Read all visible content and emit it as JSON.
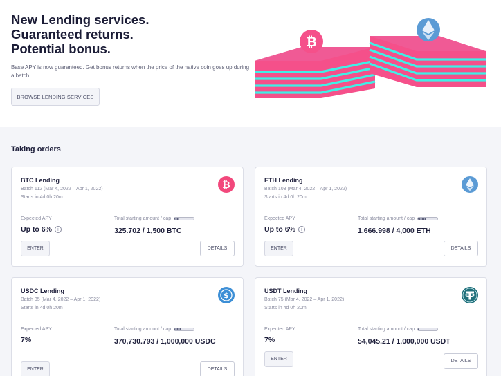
{
  "hero": {
    "title_lines": [
      "New Lending services.",
      "Guaranteed returns.",
      "Potential bonus."
    ],
    "description": "Base APY is now guaranteed. Get bonus returns when the price of the native coin goes up during a batch.",
    "browse_button": "BROWSE LENDING SERVICES"
  },
  "section": {
    "title": "Taking orders"
  },
  "cards": [
    {
      "title": "BTC Lending",
      "batch": "Batch 112 (Mar 4, 2022 – Apr 1, 2022)",
      "starts": "Starts in 4d 0h 20m",
      "apy_label": "Expected APY",
      "apy_value": "Up to 6%",
      "cap_label": "Total starting amount / cap",
      "cap_value": "325.702 / 1,500 BTC",
      "progress": 0.22,
      "enter": "ENTER",
      "details": "DETAILS",
      "icon": "bitcoin-icon",
      "icon_color": "#f2487c"
    },
    {
      "title": "ETH Lending",
      "batch": "Batch 103 (Mar 4, 2022 – Apr 1, 2022)",
      "starts": "Starts in 4d 0h 20m",
      "apy_label": "Expected APY",
      "apy_value": "Up to 6%",
      "cap_label": "Total starting amount / cap",
      "cap_value": "1,666.998 / 4,000 ETH",
      "progress": 0.42,
      "enter": "ENTER",
      "details": "DETAILS",
      "icon": "ethereum-icon",
      "icon_color": "#5b9bd5"
    },
    {
      "title": "USDC Lending",
      "batch": "Batch 35 (Mar 4, 2022 – Apr 1, 2022)",
      "starts": "Starts in 4d 0h 20m",
      "apy_label": "Expected APY",
      "apy_value": "7%",
      "cap_label": "Total starting amount / cap",
      "cap_value": "370,730.793 / 1,000,000 USDC",
      "progress": 0.37,
      "enter": "ENTER",
      "details": "DETAILS",
      "icon": "usdc-icon",
      "icon_color": "#3d8fd6"
    },
    {
      "title": "USDT Lending",
      "batch": "Batch 75 (Mar 4, 2022 – Apr 1, 2022)",
      "starts": "Starts in 4d 0h 20m",
      "apy_label": "Expected APY",
      "apy_value": "7%",
      "cap_label": "Total starting amount / cap",
      "cap_value": "54,045.21 / 1,000,000 USDT",
      "progress": 0.05,
      "enter": "ENTER",
      "details": "DETAILS",
      "icon": "tether-icon",
      "icon_color": "#1f6f7a"
    }
  ],
  "colors": {
    "accent_pink": "#f2487c",
    "accent_cyan": "#3ff0e6",
    "section_bg": "#f4f5f9"
  }
}
